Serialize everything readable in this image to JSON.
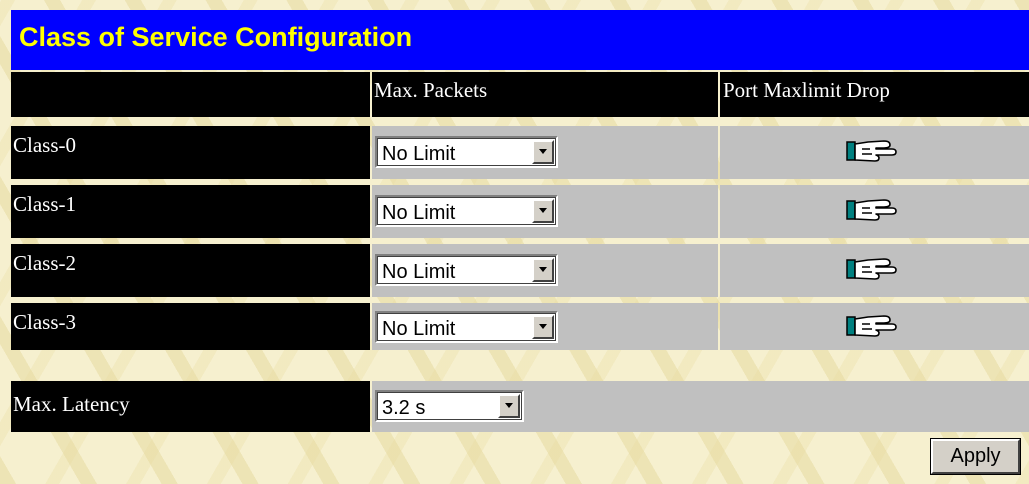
{
  "page": {
    "title": "Class of Service Configuration"
  },
  "table": {
    "headers": [
      "",
      "Max. Packets",
      "Port Maxlimit Drop"
    ],
    "rows": [
      {
        "label": "Class-0",
        "max_packets": "No Limit",
        "action_icon": "pointing-hand-icon"
      },
      {
        "label": "Class-1",
        "max_packets": "No Limit",
        "action_icon": "pointing-hand-icon"
      },
      {
        "label": "Class-2",
        "max_packets": "No Limit",
        "action_icon": "pointing-hand-icon"
      },
      {
        "label": "Class-3",
        "max_packets": "No Limit",
        "action_icon": "pointing-hand-icon"
      }
    ]
  },
  "latency": {
    "label": "Max. Latency",
    "value": "3.2 s"
  },
  "actions": {
    "apply_label": "Apply"
  },
  "colors": {
    "title_bg": "#0000ff",
    "title_text": "#ffff00",
    "label_cell_bg": "#000000",
    "label_cell_text": "#ffffff",
    "control_cell_bg": "#c0c0c0",
    "page_bg": "#f6f0cf"
  }
}
